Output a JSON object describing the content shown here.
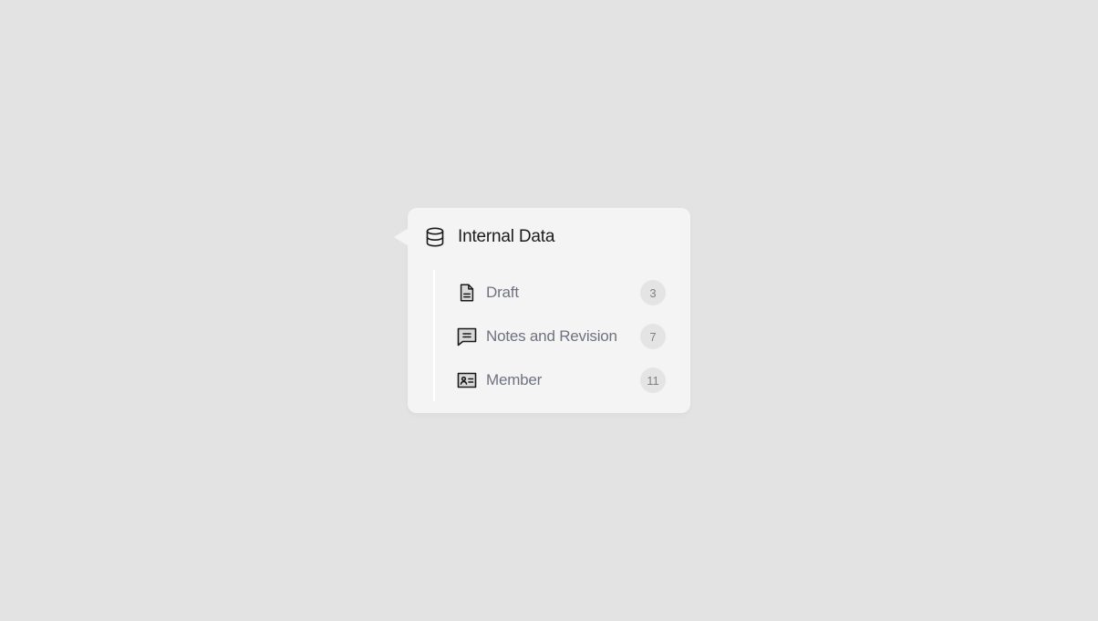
{
  "popover": {
    "title": "Internal Data",
    "title_icon": "database-icon",
    "items": [
      {
        "label": "Draft",
        "count": "3",
        "icon": "document-icon"
      },
      {
        "label": "Notes and Revision",
        "count": "7",
        "icon": "chat-message-icon"
      },
      {
        "label": "Member",
        "count": "11",
        "icon": "id-card-icon"
      }
    ]
  },
  "colors": {
    "background": "#e3e3e3",
    "panel": "#f4f4f4",
    "title_text": "#1c1c1c",
    "item_text": "#6f7380",
    "badge_bg": "#e4e4e4",
    "badge_text": "#808080"
  }
}
